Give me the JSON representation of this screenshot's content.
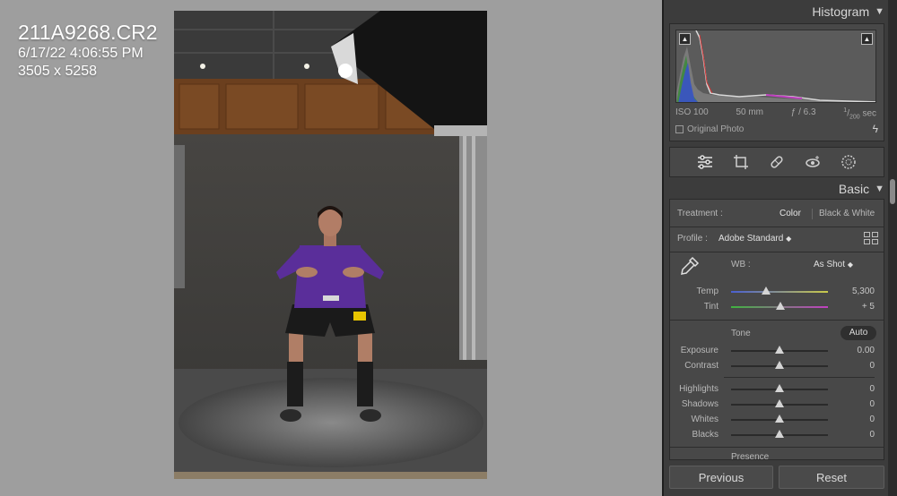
{
  "overlay": {
    "filename": "211A9268.CR2",
    "datetime": "6/17/22 4:06:55 PM",
    "dimensions": "3505 x 5258"
  },
  "histogram": {
    "title": "Histogram",
    "iso": "ISO 100",
    "focal": "50 mm",
    "aperture": "ƒ / 6.3",
    "shutter_num": "1",
    "shutter_den": "200",
    "shutter_unit": "sec",
    "original_photo": "Original Photo"
  },
  "tools": [
    "edit-sliders",
    "crop",
    "healing",
    "red-eye",
    "masking"
  ],
  "basic": {
    "title": "Basic",
    "treatment_label": "Treatment :",
    "treatment_color": "Color",
    "treatment_bw": "Black & White",
    "profile_label": "Profile :",
    "profile_value": "Adobe Standard",
    "wb_label": "WB :",
    "wb_value": "As Shot",
    "tone_label": "Tone",
    "auto_label": "Auto",
    "presence_label": "Presence"
  },
  "sliders": {
    "temp": {
      "label": "Temp",
      "value": "5,300",
      "pos": 0.36
    },
    "tint": {
      "label": "Tint",
      "value": "+ 5",
      "pos": 0.51
    },
    "exposure": {
      "label": "Exposure",
      "value": "0.00",
      "pos": 0.5
    },
    "contrast": {
      "label": "Contrast",
      "value": "0",
      "pos": 0.5
    },
    "highlights": {
      "label": "Highlights",
      "value": "0",
      "pos": 0.5
    },
    "shadows": {
      "label": "Shadows",
      "value": "0",
      "pos": 0.5
    },
    "whites": {
      "label": "Whites",
      "value": "0",
      "pos": 0.5
    },
    "blacks": {
      "label": "Blacks",
      "value": "0",
      "pos": 0.5
    }
  },
  "buttons": {
    "previous": "Previous",
    "reset": "Reset"
  },
  "colors": {
    "panel_bg": "#3c3c3c",
    "canvas_bg": "#9e9e9e",
    "jersey": "#5a2e9a"
  }
}
